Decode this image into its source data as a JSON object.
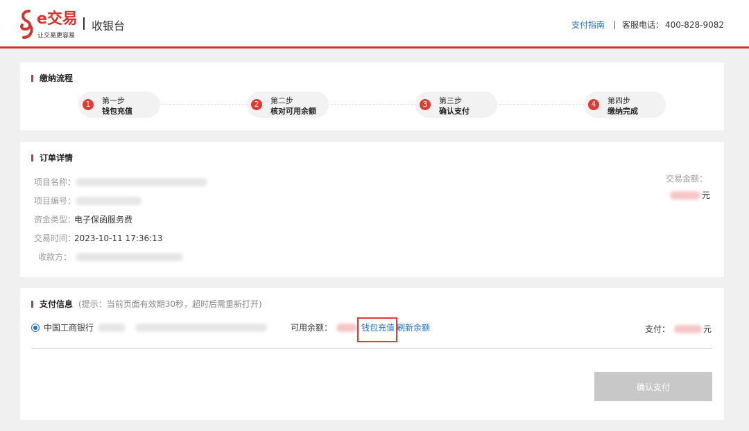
{
  "header": {
    "logo_title": "e交易",
    "logo_subtitle": "让交易更容易",
    "page_title": "收银台",
    "guide_link": "支付指南",
    "hotline_label": "客服电话：",
    "hotline_value": "400-828-9082",
    "brand_color": "#d9322a"
  },
  "process": {
    "title": "缴纳流程",
    "steps": [
      {
        "num": "1",
        "line1": "第一步",
        "line2": "钱包充值"
      },
      {
        "num": "2",
        "line1": "第二步",
        "line2": "核对可用余额"
      },
      {
        "num": "3",
        "line1": "第三步",
        "line2": "确认支付"
      },
      {
        "num": "4",
        "line1": "第四步",
        "line2": "缴纳完成"
      }
    ]
  },
  "order": {
    "title": "订单详情",
    "fields": [
      {
        "label": "项目名称：",
        "value": ""
      },
      {
        "label": "项目编号：",
        "value": ""
      },
      {
        "label": "资金类型：",
        "value": "电子保函服务费"
      },
      {
        "label": "交易时间：",
        "value": "2023-10-11 17:36:13"
      },
      {
        "label": "收款方：",
        "value": ""
      }
    ],
    "amount_label": "交易金额：",
    "amount_unit": "元"
  },
  "payment": {
    "title": "支付信息",
    "hint": "(提示：当前页面有效期30秒，超时后需重新打开)",
    "bank_name": "中国工商银行",
    "available_label": "可用余额：",
    "recharge_link": "钱包充值",
    "refresh_link": "刷新余额",
    "pay_label": "支付：",
    "pay_unit": "元",
    "confirm_button": "确认支付",
    "link_color": "#1f6fd1"
  }
}
